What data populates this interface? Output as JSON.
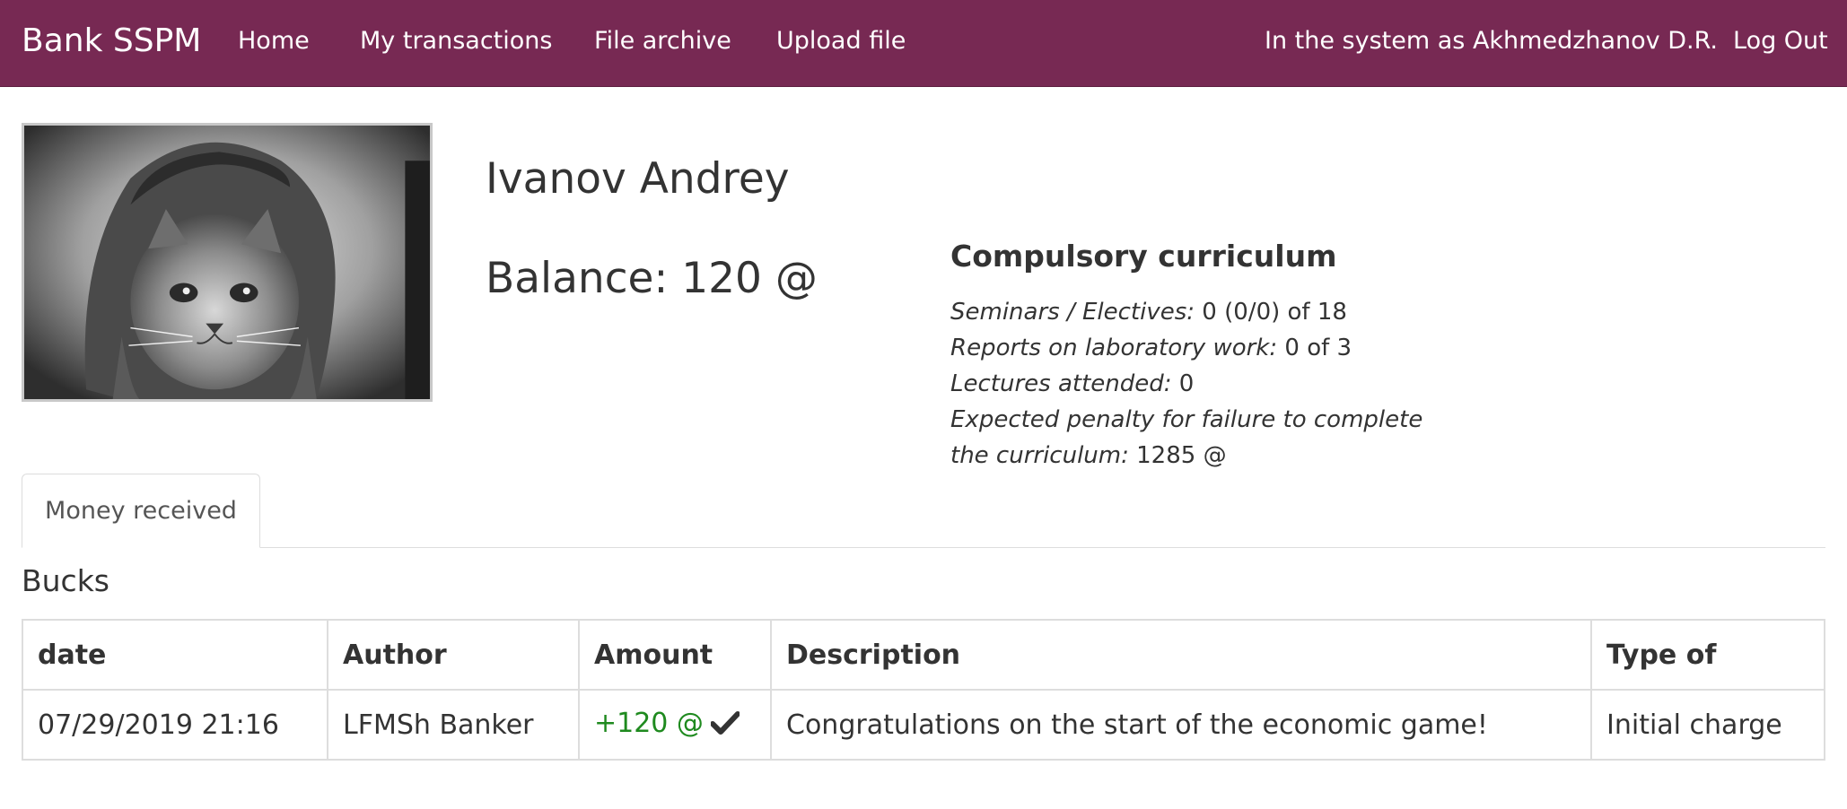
{
  "navbar": {
    "brand": "Bank SSPM",
    "links": [
      "Home",
      "My transactions",
      "File archive",
      "Upload file"
    ],
    "user_text": "In the system as Akhmedzhanov D.R.",
    "logout": "Log Out",
    "bg_color": "#772953"
  },
  "profile": {
    "avatar_icon": "cat-in-hood-photo",
    "name": "Ivanov Andrey",
    "balance": "Balance: 120 @"
  },
  "curriculum": {
    "title": "Compulsory curriculum",
    "lines": [
      {
        "label": "Seminars / Electives:",
        "value": " 0 (0/0) of 18"
      },
      {
        "label": "Reports on laboratory work:",
        "value": " 0 of 3"
      },
      {
        "label": "Lectures attended:",
        "value": " 0"
      },
      {
        "label": "Expected penalty for failure to complete the curriculum:",
        "value": " 1285 @"
      }
    ]
  },
  "tabs": [
    {
      "label": "Money received",
      "active": true
    }
  ],
  "section_title": "Bucks",
  "table": {
    "headers": [
      "date",
      "Author",
      "Amount",
      "Description",
      "Type of"
    ],
    "rows": [
      {
        "date": "07/29/2019 21:16",
        "author": "LFMSh Banker",
        "amount": "+120 @",
        "status_icon": "check-icon",
        "description": "Congratulations on the start of the economic game!",
        "type": "Initial charge"
      }
    ],
    "amount_color": "#1f8a1f"
  }
}
